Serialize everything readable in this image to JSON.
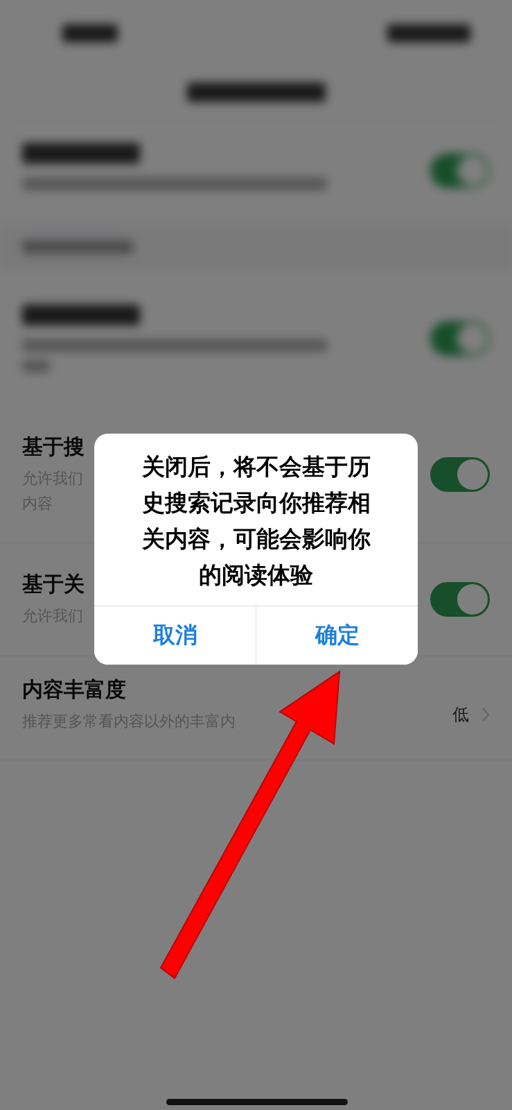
{
  "settings": [
    {
      "kind": "blurred",
      "on": true,
      "wrapped": false
    },
    {
      "kind": "section"
    },
    {
      "kind": "blurred",
      "on": true,
      "wrapped": true
    },
    {
      "kind": "switch",
      "title": "基于搜",
      "subtitle_lines": [
        "允许我们",
        "内容"
      ],
      "on": true
    },
    {
      "kind": "switch",
      "title": "基于关",
      "subtitle_lines": [
        "允许我们"
      ],
      "on": true
    },
    {
      "kind": "value",
      "title": "内容丰富度",
      "subtitle_lines": [
        "推荐更多常看内容以外的丰富内"
      ],
      "value": "低"
    }
  ],
  "dialog": {
    "message": "关闭后，将不会基于历史搜索记录向你推荐相关内容，可能会影响你的阅读体验",
    "buttons": [
      {
        "label": "取消"
      },
      {
        "label": "确定"
      }
    ]
  }
}
